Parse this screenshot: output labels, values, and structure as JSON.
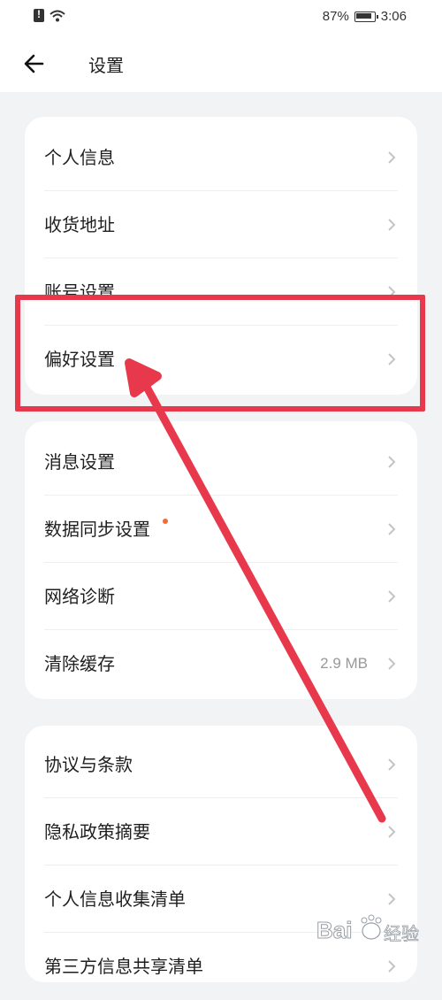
{
  "status": {
    "battery": "87%",
    "time": "3:06"
  },
  "header": {
    "title": "设置"
  },
  "groups": [
    {
      "items": [
        {
          "label": "个人信息"
        },
        {
          "label": "收货地址"
        },
        {
          "label": "账号设置"
        },
        {
          "label": "偏好设置"
        }
      ]
    },
    {
      "items": [
        {
          "label": "消息设置"
        },
        {
          "label": "数据同步设置"
        },
        {
          "label": "网络诊断"
        },
        {
          "label": "清除缓存",
          "value": "2.9 MB"
        }
      ]
    },
    {
      "items": [
        {
          "label": "协议与条款"
        },
        {
          "label": "隐私政策摘要"
        },
        {
          "label": "个人信息收集清单"
        },
        {
          "label": "第三方信息共享清单"
        }
      ]
    }
  ],
  "colors": {
    "highlight": "#e8394c",
    "dot": "#f26b3a"
  },
  "watermark": {
    "text": "Bai经验"
  }
}
